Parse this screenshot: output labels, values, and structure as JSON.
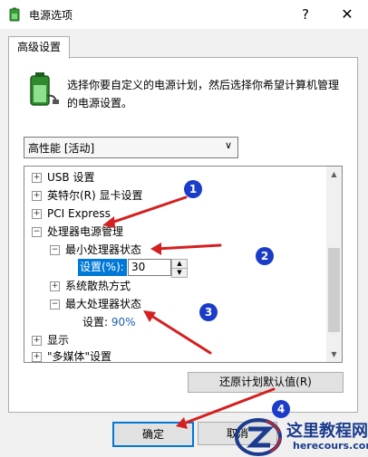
{
  "window": {
    "title": "电源选项",
    "help_button": "?",
    "close_button": "✕"
  },
  "tab_label": "高级设置",
  "description": "选择你要自定义的电源计划，然后选择你希望计算机管理的电源设置。",
  "plan_select": {
    "value": "高性能 [活动]"
  },
  "tree": {
    "usb": "USB 设置",
    "intel_gpu": "英特尔(R) 显卡设置",
    "pci": "PCI Express",
    "cpu_power": "处理器电源管理",
    "min_state": "最小处理器状态",
    "setting_label": "设置(%):",
    "min_value": "30",
    "cooling": "系统散热方式",
    "max_state": "最大处理器状态",
    "max_label": "设置:",
    "max_value": "90%",
    "display": "显示",
    "multimedia": "\"多媒体\"设置"
  },
  "buttons": {
    "restore": "还原计划默认值(R)",
    "ok": "确定",
    "cancel": "取消"
  },
  "markers": [
    "1",
    "2",
    "3",
    "4"
  ],
  "watermark": {
    "name": "这里教程网",
    "url": "herecours.com"
  },
  "colors": {
    "annotation_arrow": "#d42020",
    "marker": "#1a3cc8",
    "selection": "#0078d7"
  }
}
